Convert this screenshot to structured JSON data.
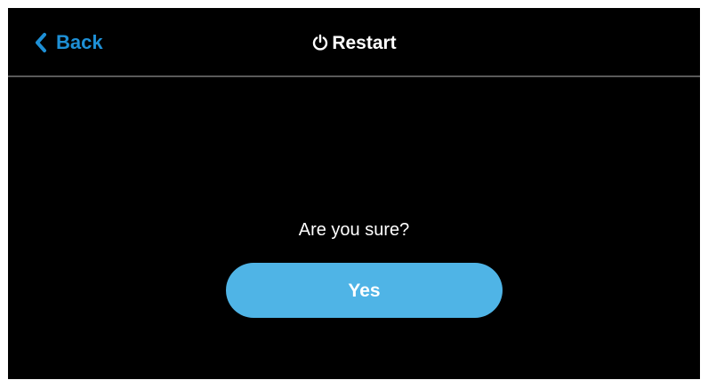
{
  "header": {
    "back_label": "Back",
    "back_icon": "chevron-left-icon",
    "title": "Restart",
    "title_icon": "power-icon"
  },
  "dialog": {
    "question": "Are you sure?",
    "confirm_label": "Yes"
  },
  "colors": {
    "background": "#000000",
    "accent": "#1e90d6",
    "button": "#4fb4e6",
    "text": "#ffffff",
    "divider": "#5a5a5a"
  }
}
